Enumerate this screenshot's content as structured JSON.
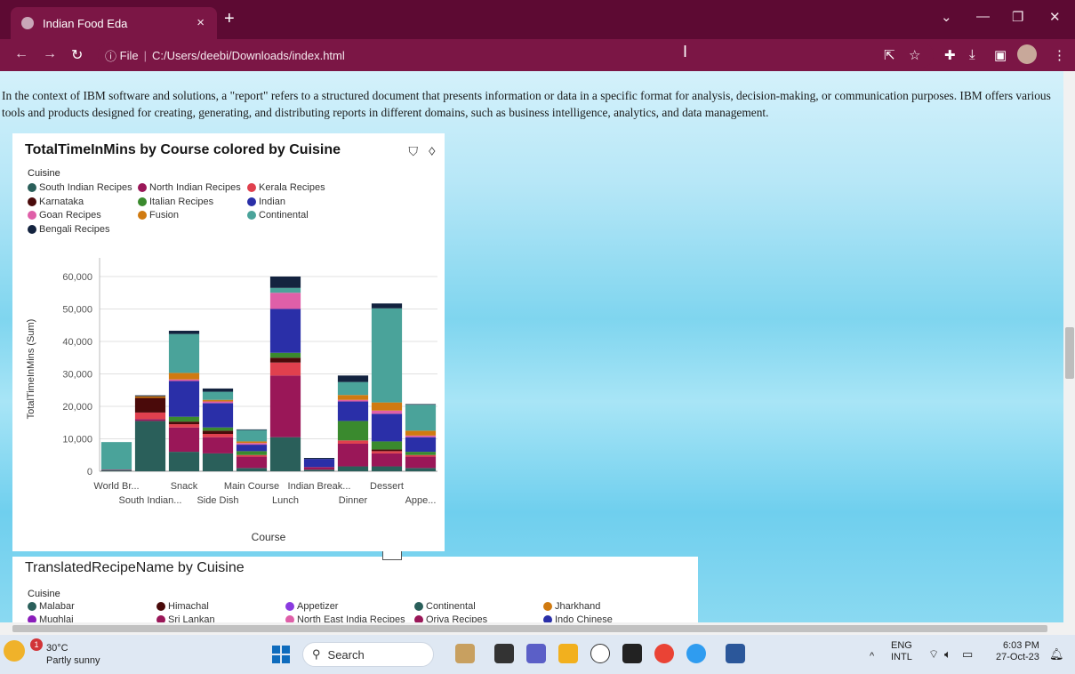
{
  "browser": {
    "tab_title": "Indian Food Eda",
    "tab_close": "×",
    "new_tab": "+",
    "address_prefix": "File",
    "address": "C:/Users/deebi/Downloads/index.html"
  },
  "page": {
    "intro_text": "In the context of IBM software and solutions, a \"report\" refers to a structured document that presents information or data in a specific format for analysis, decision-making, or communication purposes. IBM offers various tools and products designed for creating, generating, and distributing reports in different domains, such as business intelligence, analytics, and data management."
  },
  "chart1": {
    "title": "TotalTimeInMins by Course colored by Cuisine",
    "legend_title": "Cuisine",
    "legend": [
      {
        "name": "South Indian Recipes",
        "color": "#2a5f5a"
      },
      {
        "name": "North Indian Recipes",
        "color": "#9a1758"
      },
      {
        "name": "Kerala Recipes",
        "color": "#e0404e"
      },
      {
        "name": "Karnataka",
        "color": "#4a0a0a"
      },
      {
        "name": "Italian Recipes",
        "color": "#3a8a2e"
      },
      {
        "name": "Indian",
        "color": "#2a2fa8"
      },
      {
        "name": "Goan Recipes",
        "color": "#df5fa8"
      },
      {
        "name": "Fusion",
        "color": "#d07a10"
      },
      {
        "name": "Continental",
        "color": "#4aa39a"
      },
      {
        "name": "Bengali Recipes",
        "color": "#13233f"
      }
    ]
  },
  "chart_data": {
    "type": "bar",
    "stacked": true,
    "title": "TotalTimeInMins by Course colored by Cuisine",
    "xlabel": "Course",
    "ylabel": "TotalTimeInMins (Sum)",
    "ylim": [
      0,
      65000
    ],
    "yticks": [
      "0",
      "10,000",
      "20,000",
      "30,000",
      "40,000",
      "50,000",
      "60,000"
    ],
    "ytick_values": [
      0,
      10000,
      20000,
      30000,
      40000,
      50000,
      60000
    ],
    "grid": true,
    "legend_placement": "top-left",
    "categories": [
      "World Br...",
      "South Indian...",
      "Snack",
      "Side Dish",
      "Main Course",
      "Lunch",
      "Indian Break...",
      "Dinner",
      "Dessert",
      "Appe..."
    ],
    "series": [
      {
        "name": "South Indian Recipes",
        "values": [
          300,
          15500,
          6000,
          5500,
          1000,
          10500,
          500,
          1500,
          1500,
          1000
        ]
      },
      {
        "name": "North Indian Recipes",
        "values": [
          200,
          600,
          7500,
          5000,
          3500,
          19000,
          800,
          7000,
          4000,
          3500
        ]
      },
      {
        "name": "Kerala Recipes",
        "values": [
          0,
          2000,
          1000,
          1000,
          500,
          4000,
          0,
          1000,
          700,
          500
        ]
      },
      {
        "name": "Karnataka",
        "values": [
          0,
          4500,
          800,
          1000,
          0,
          1500,
          0,
          0,
          500,
          0
        ]
      },
      {
        "name": "Italian Recipes",
        "values": [
          0,
          0,
          1500,
          1000,
          1200,
          1500,
          0,
          6000,
          2500,
          1000
        ]
      },
      {
        "name": "Indian",
        "values": [
          0,
          0,
          11000,
          7500,
          2000,
          13500,
          2500,
          6000,
          8500,
          4500
        ]
      },
      {
        "name": "Goan Recipes",
        "values": [
          0,
          0,
          500,
          500,
          500,
          5000,
          0,
          500,
          1000,
          500
        ]
      },
      {
        "name": "Fusion",
        "values": [
          0,
          500,
          2000,
          500,
          500,
          0,
          0,
          1500,
          2500,
          1500
        ]
      },
      {
        "name": "Continental",
        "values": [
          8500,
          0,
          12000,
          2500,
          3500,
          1500,
          0,
          4000,
          29000,
          8000
        ]
      },
      {
        "name": "Bengali Recipes",
        "values": [
          0,
          300,
          1000,
          1000,
          200,
          3500,
          300,
          2000,
          1500,
          200
        ]
      }
    ]
  },
  "chart2": {
    "title": "TranslatedRecipeName by Cuisine",
    "legend_title": "Cuisine",
    "legend": [
      {
        "name": "Malabar",
        "color": "#2a5f5a"
      },
      {
        "name": "Himachal",
        "color": "#4a0a0a"
      },
      {
        "name": "Appetizer",
        "color": "#8a3be0"
      },
      {
        "name": "Continental",
        "color": "#2a5f5a"
      },
      {
        "name": "Jharkhand",
        "color": "#d07a10"
      },
      {
        "name": "Mughlai",
        "color": "#8a1dbb"
      },
      {
        "name": "Sri Lankan",
        "color": "#9a1758"
      },
      {
        "name": "North East India Recipes",
        "color": "#df5fa8"
      },
      {
        "name": "Oriya Recipes",
        "color": "#9a1758"
      },
      {
        "name": "Indo Chinese",
        "color": "#2a2fa8"
      }
    ]
  },
  "taskbar": {
    "temp": "30°C",
    "weather": "Partly sunny",
    "badge": "1",
    "search_label": "Search",
    "lang1": "ENG",
    "lang2": "INTL",
    "time": "6:03 PM",
    "date": "27-Oct-23"
  }
}
